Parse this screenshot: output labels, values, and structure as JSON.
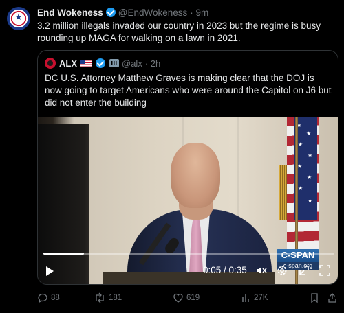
{
  "tweet": {
    "author_name": "End Wokeness",
    "handle": "@EndWokeness",
    "time": "· 9m",
    "text": "3.2 million illegals invaded our country in 2023 but the regime is busy rounding up MAGA for walking on a lawn in 2021."
  },
  "quote": {
    "author_name": "ALX",
    "handle": "@alx",
    "time": "· 2h",
    "text": "DC U.S. Attorney Matthew Graves is making clear that the DOJ is now going to target Americans who were around the Capitol on J6 but did not enter the building"
  },
  "video": {
    "current_time": "0:05",
    "duration": "0:35",
    "time_display": "0:05 / 0:35",
    "progress": 0.14,
    "network_logo": "C-SPAN",
    "network_url": "c-span.org"
  },
  "actions": {
    "replies": "88",
    "reposts": "181",
    "likes": "619",
    "views": "27K"
  },
  "colors": {
    "background": "#000000",
    "text": "#e7e9ea",
    "muted": "#71767b",
    "verified": "#1d9bf0",
    "border": "#2f3336"
  }
}
